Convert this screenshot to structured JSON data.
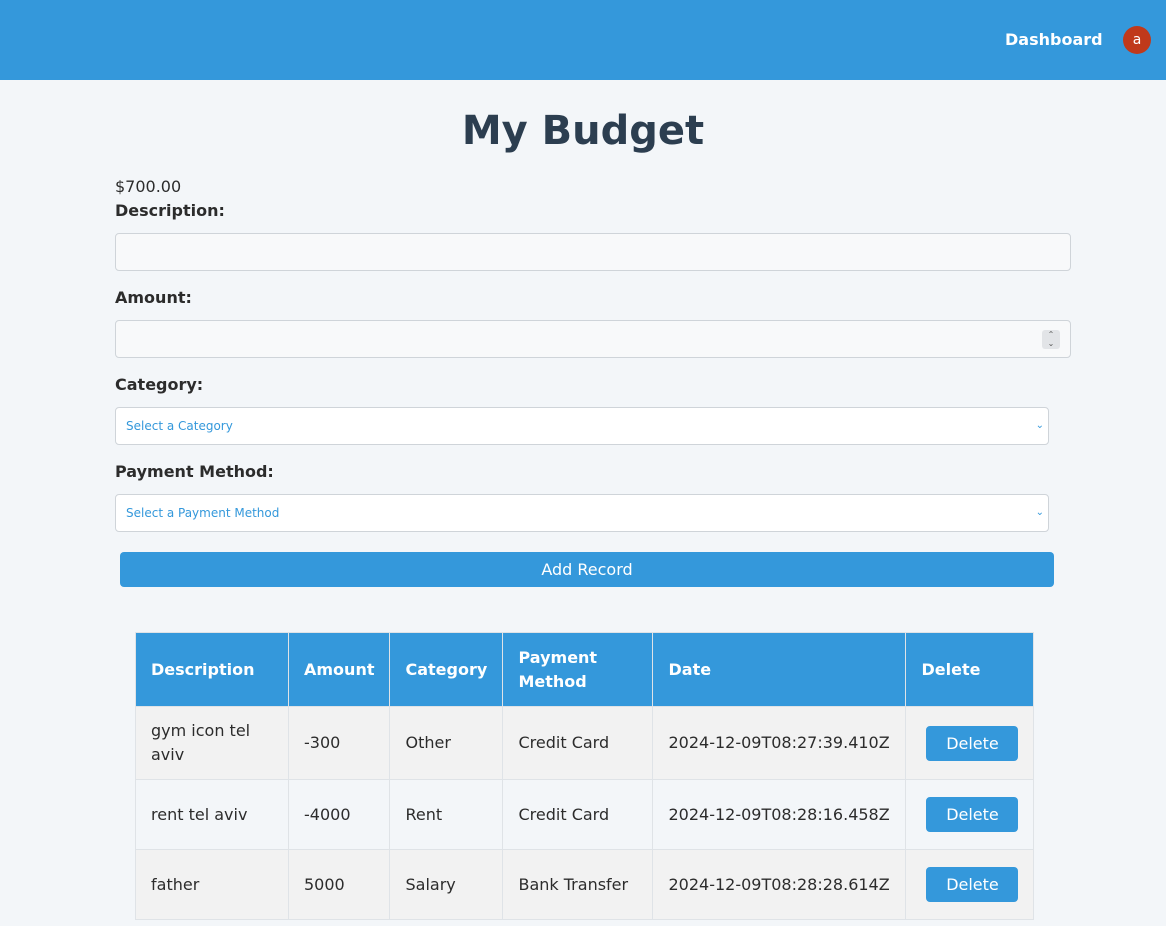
{
  "header": {
    "nav_link": "Dashboard",
    "avatar_letter": "a",
    "bar_color": "#3498db",
    "avatar_color": "#c0391b"
  },
  "page": {
    "title": "My Budget",
    "balance": "$700.00"
  },
  "form": {
    "description_label": "Description:",
    "description_value": "",
    "amount_label": "Amount:",
    "amount_value": "",
    "category_label": "Category:",
    "category_selected": "Select a Category",
    "payment_label": "Payment Method:",
    "payment_selected": "Select a Payment Method",
    "submit_label": "Add Record"
  },
  "table": {
    "headers": [
      "Description",
      "Amount",
      "Category",
      "Payment Method",
      "Date",
      "Delete"
    ],
    "rows": [
      {
        "description": "gym icon tel aviv",
        "amount": "-300",
        "category": "Other",
        "payment": "Credit Card",
        "date": "2024-12-09T08:27:39.410Z",
        "delete_label": "Delete"
      },
      {
        "description": "rent tel aviv",
        "amount": "-4000",
        "category": "Rent",
        "payment": "Credit Card",
        "date": "2024-12-09T08:28:16.458Z",
        "delete_label": "Delete"
      },
      {
        "description": "father",
        "amount": "5000",
        "category": "Salary",
        "payment": "Bank Transfer",
        "date": "2024-12-09T08:28:28.614Z",
        "delete_label": "Delete"
      }
    ]
  }
}
